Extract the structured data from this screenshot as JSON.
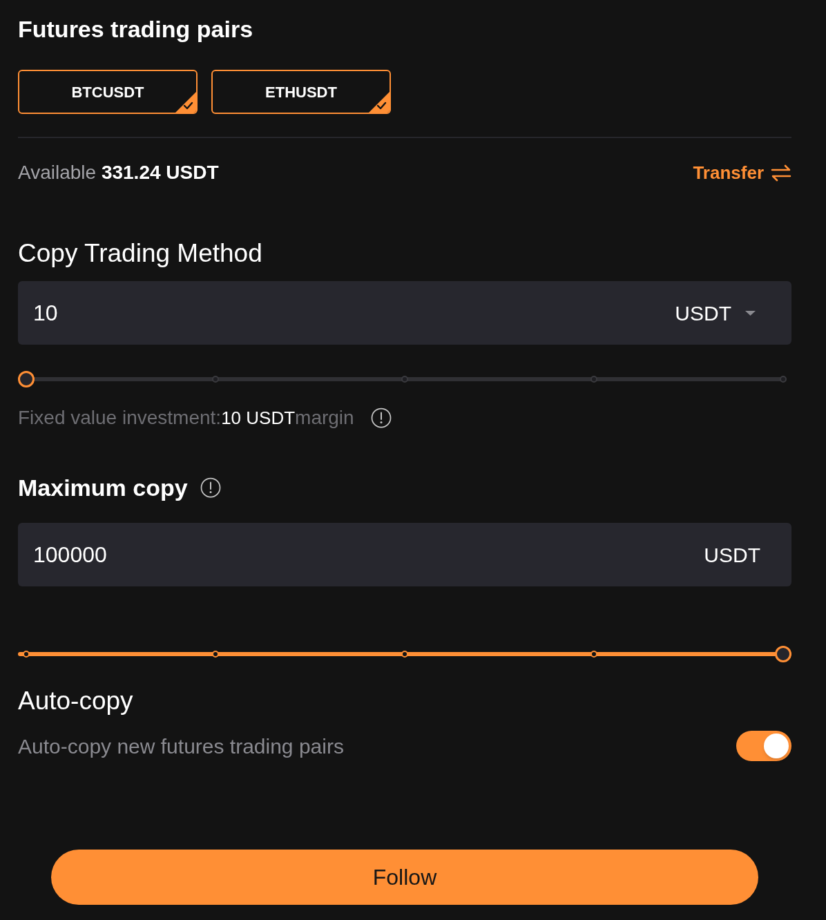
{
  "title": "Futures trading pairs",
  "pairs": [
    {
      "label": "BTCUSDT",
      "selected": true
    },
    {
      "label": "ETHUSDT",
      "selected": true
    }
  ],
  "balance": {
    "text": "Available **331.24 USDT**"
  },
  "transfer": {
    "label": "Transfer"
  },
  "copy_method": {
    "heading": "Copy Trading Method",
    "field": {
      "value": "10",
      "unit": "USDT",
      "dropdown": true
    },
    "slider": {
      "level": 0
    },
    "note": "Fixed value investment:**10 USDT**margin"
  },
  "maximum_copy": {
    "heading": "Maximum copy",
    "field": {
      "value": "100000",
      "unit": "USDT"
    },
    "slider": {
      "level": 1
    }
  },
  "auto_copy": {
    "heading": "Auto-copy",
    "label": "Auto-copy new futures trading pairs",
    "on": true
  },
  "follow_button": {
    "label": "Follow"
  }
}
